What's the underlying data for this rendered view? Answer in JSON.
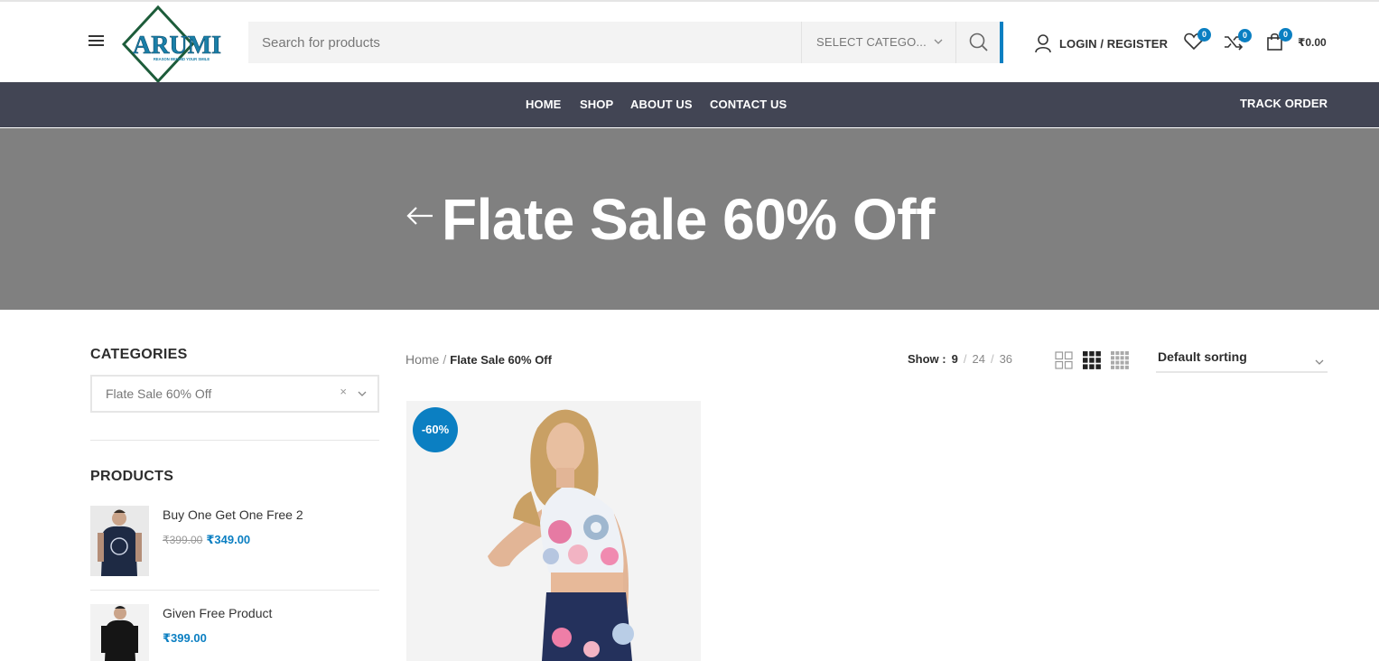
{
  "header": {
    "search_placeholder": "Search for products",
    "category_select": "SELECT CATEGO...",
    "login_label": "LOGIN / REGISTER",
    "wishlist_count": "0",
    "compare_count": "0",
    "cart_count": "0",
    "cart_total": "₹0.00",
    "logo_text": "ARUMI",
    "logo_tagline": "REASON BEHIND YOUR SMILE"
  },
  "nav": {
    "items": [
      "HOME",
      "SHOP",
      "ABOUT US",
      "CONTACT US"
    ],
    "track_order": "TRACK ORDER"
  },
  "hero": {
    "back_arrow": "←",
    "title": "Flate Sale 60% Off"
  },
  "sidebar": {
    "categories_title": "CATEGORIES",
    "category_selected": "Flate Sale 60% Off",
    "clear": "×",
    "products_title": "PRODUCTS",
    "products": [
      {
        "name": "Buy One Get One Free 2",
        "old_price": "₹399.00",
        "price": "₹349.00"
      },
      {
        "name": "Given Free Product",
        "old_price": "",
        "price": "₹399.00"
      }
    ]
  },
  "toolbar": {
    "breadcrumb_home": "Home",
    "breadcrumb_sep": "/",
    "breadcrumb_current": "Flate Sale 60% Off",
    "show_label": "Show :",
    "show_options": [
      "9",
      "24",
      "36"
    ],
    "show_sep": "/",
    "sorting": "Default sorting"
  },
  "product_card": {
    "badge": "-60%"
  },
  "colors": {
    "accent": "#0b7fc2",
    "nav_bg": "#424554",
    "hero_bg": "#808080",
    "logo_green": "#1d5c3a"
  }
}
